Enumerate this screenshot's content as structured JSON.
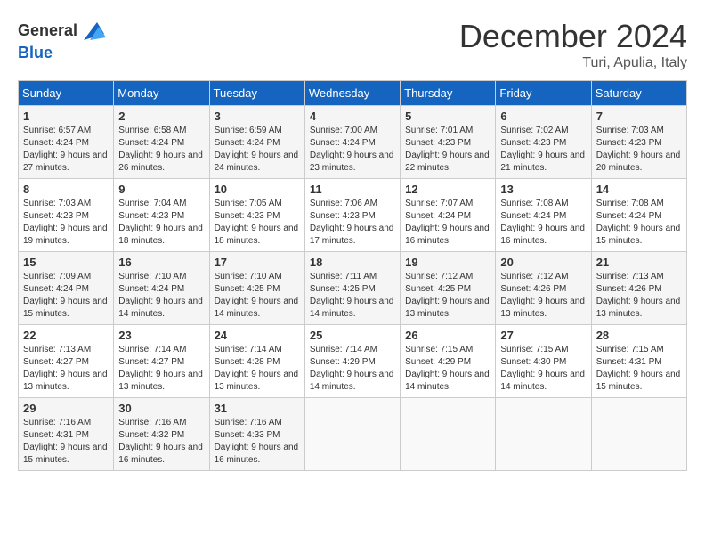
{
  "logo": {
    "general": "General",
    "blue": "Blue"
  },
  "title": {
    "month": "December 2024",
    "location": "Turi, Apulia, Italy"
  },
  "headers": [
    "Sunday",
    "Monday",
    "Tuesday",
    "Wednesday",
    "Thursday",
    "Friday",
    "Saturday"
  ],
  "weeks": [
    [
      {
        "day": "1",
        "sunrise": "6:57 AM",
        "sunset": "4:24 PM",
        "daylight": "9 hours and 27 minutes."
      },
      {
        "day": "2",
        "sunrise": "6:58 AM",
        "sunset": "4:24 PM",
        "daylight": "9 hours and 26 minutes."
      },
      {
        "day": "3",
        "sunrise": "6:59 AM",
        "sunset": "4:24 PM",
        "daylight": "9 hours and 24 minutes."
      },
      {
        "day": "4",
        "sunrise": "7:00 AM",
        "sunset": "4:24 PM",
        "daylight": "9 hours and 23 minutes."
      },
      {
        "day": "5",
        "sunrise": "7:01 AM",
        "sunset": "4:23 PM",
        "daylight": "9 hours and 22 minutes."
      },
      {
        "day": "6",
        "sunrise": "7:02 AM",
        "sunset": "4:23 PM",
        "daylight": "9 hours and 21 minutes."
      },
      {
        "day": "7",
        "sunrise": "7:03 AM",
        "sunset": "4:23 PM",
        "daylight": "9 hours and 20 minutes."
      }
    ],
    [
      {
        "day": "8",
        "sunrise": "7:03 AM",
        "sunset": "4:23 PM",
        "daylight": "9 hours and 19 minutes."
      },
      {
        "day": "9",
        "sunrise": "7:04 AM",
        "sunset": "4:23 PM",
        "daylight": "9 hours and 18 minutes."
      },
      {
        "day": "10",
        "sunrise": "7:05 AM",
        "sunset": "4:23 PM",
        "daylight": "9 hours and 18 minutes."
      },
      {
        "day": "11",
        "sunrise": "7:06 AM",
        "sunset": "4:23 PM",
        "daylight": "9 hours and 17 minutes."
      },
      {
        "day": "12",
        "sunrise": "7:07 AM",
        "sunset": "4:24 PM",
        "daylight": "9 hours and 16 minutes."
      },
      {
        "day": "13",
        "sunrise": "7:08 AM",
        "sunset": "4:24 PM",
        "daylight": "9 hours and 16 minutes."
      },
      {
        "day": "14",
        "sunrise": "7:08 AM",
        "sunset": "4:24 PM",
        "daylight": "9 hours and 15 minutes."
      }
    ],
    [
      {
        "day": "15",
        "sunrise": "7:09 AM",
        "sunset": "4:24 PM",
        "daylight": "9 hours and 15 minutes."
      },
      {
        "day": "16",
        "sunrise": "7:10 AM",
        "sunset": "4:24 PM",
        "daylight": "9 hours and 14 minutes."
      },
      {
        "day": "17",
        "sunrise": "7:10 AM",
        "sunset": "4:25 PM",
        "daylight": "9 hours and 14 minutes."
      },
      {
        "day": "18",
        "sunrise": "7:11 AM",
        "sunset": "4:25 PM",
        "daylight": "9 hours and 14 minutes."
      },
      {
        "day": "19",
        "sunrise": "7:12 AM",
        "sunset": "4:25 PM",
        "daylight": "9 hours and 13 minutes."
      },
      {
        "day": "20",
        "sunrise": "7:12 AM",
        "sunset": "4:26 PM",
        "daylight": "9 hours and 13 minutes."
      },
      {
        "day": "21",
        "sunrise": "7:13 AM",
        "sunset": "4:26 PM",
        "daylight": "9 hours and 13 minutes."
      }
    ],
    [
      {
        "day": "22",
        "sunrise": "7:13 AM",
        "sunset": "4:27 PM",
        "daylight": "9 hours and 13 minutes."
      },
      {
        "day": "23",
        "sunrise": "7:14 AM",
        "sunset": "4:27 PM",
        "daylight": "9 hours and 13 minutes."
      },
      {
        "day": "24",
        "sunrise": "7:14 AM",
        "sunset": "4:28 PM",
        "daylight": "9 hours and 13 minutes."
      },
      {
        "day": "25",
        "sunrise": "7:14 AM",
        "sunset": "4:29 PM",
        "daylight": "9 hours and 14 minutes."
      },
      {
        "day": "26",
        "sunrise": "7:15 AM",
        "sunset": "4:29 PM",
        "daylight": "9 hours and 14 minutes."
      },
      {
        "day": "27",
        "sunrise": "7:15 AM",
        "sunset": "4:30 PM",
        "daylight": "9 hours and 14 minutes."
      },
      {
        "day": "28",
        "sunrise": "7:15 AM",
        "sunset": "4:31 PM",
        "daylight": "9 hours and 15 minutes."
      }
    ],
    [
      {
        "day": "29",
        "sunrise": "7:16 AM",
        "sunset": "4:31 PM",
        "daylight": "9 hours and 15 minutes."
      },
      {
        "day": "30",
        "sunrise": "7:16 AM",
        "sunset": "4:32 PM",
        "daylight": "9 hours and 16 minutes."
      },
      {
        "day": "31",
        "sunrise": "7:16 AM",
        "sunset": "4:33 PM",
        "daylight": "9 hours and 16 minutes."
      },
      null,
      null,
      null,
      null
    ]
  ],
  "labels": {
    "sunrise": "Sunrise:",
    "sunset": "Sunset:",
    "daylight": "Daylight:"
  }
}
